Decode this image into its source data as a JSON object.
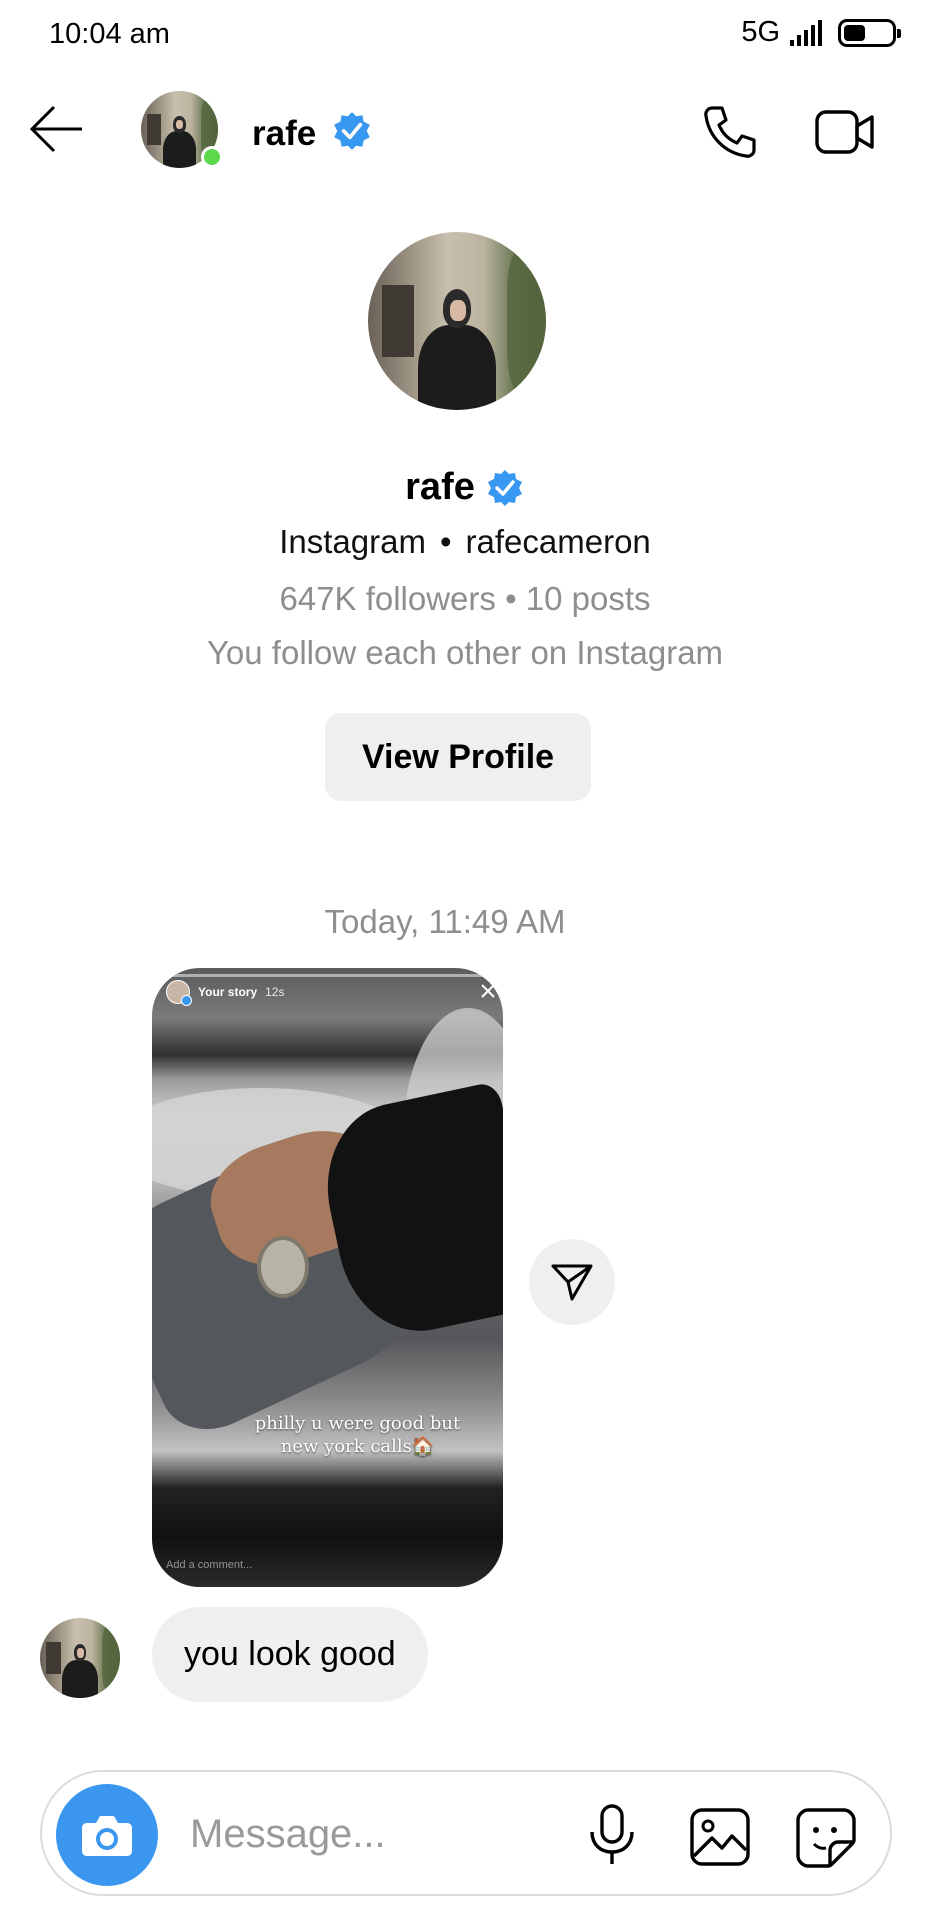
{
  "status_bar": {
    "time": "10:04 am",
    "network": "5G",
    "battery_level": 0.45
  },
  "header": {
    "back_icon": "arrow-left-icon",
    "name": "rafe",
    "verified": true,
    "online": true,
    "call_icon": "phone-icon",
    "video_icon": "video-camera-icon"
  },
  "profile": {
    "name": "rafe",
    "platform": "Instagram",
    "separator": "•",
    "username": "rafecameron",
    "stats": "647K followers • 10 posts",
    "follow_status": "You follow each other on Instagram",
    "view_profile_label": "View Profile"
  },
  "chat": {
    "timestamp": "Today, 11:49 AM",
    "story": {
      "label": "Your story",
      "age": "12s",
      "caption_line1": "philly u were good but",
      "caption_line2": "new york calls🏠",
      "comment_placeholder": "Add a comment..."
    },
    "share_icon": "paper-plane-icon",
    "messages": [
      {
        "text": "you look good",
        "from": "rafe"
      }
    ]
  },
  "composer": {
    "placeholder": "Message...",
    "camera_icon": "camera-icon",
    "mic_icon": "microphone-icon",
    "gallery_icon": "image-icon",
    "sticker_icon": "sticker-icon"
  },
  "colors": {
    "accent_blue": "#3b96f0",
    "verified_blue": "#3897f0",
    "online_green": "#5bd84b",
    "bubble_gray": "#efefef",
    "muted_text": "#8e8e8e"
  }
}
